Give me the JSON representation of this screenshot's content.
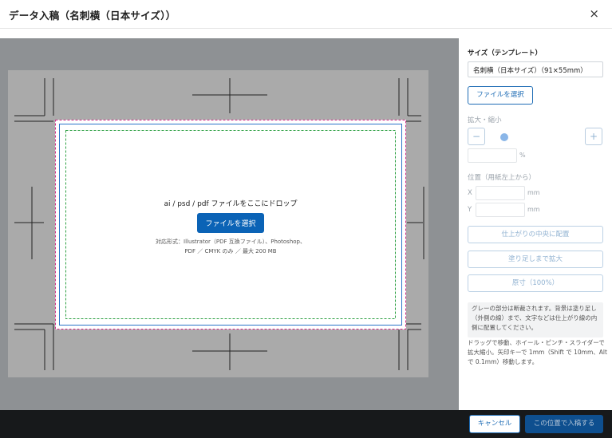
{
  "header": {
    "title": "データ入稿（名刺横（日本サイズ））",
    "close_icon": "×"
  },
  "preview": {
    "drop_title": "ai / psd / pdf ファイルをここにドロップ",
    "pick_button": "ファイルを選択",
    "formats_line1": "対応形式：Illustrator（PDF 互換ファイル）、Photoshop、",
    "formats_line2": "PDF ／ CMYK のみ ／ 最大 200 MB",
    "colors": {
      "bleed": "#d0308a",
      "trim": "#2a73c9",
      "safe": "#2ea043",
      "sheet": "#aaaaaa",
      "background": "#8e9194"
    }
  },
  "panel": {
    "size_title": "サイズ（テンプレート）",
    "size_value": "名刺横（日本サイズ）（91×55mm）",
    "file_button": "ファイルを選択",
    "scale_title": "拡大・縮小",
    "minus": "−",
    "plus": "+",
    "percent_unit": "%",
    "position_title": "位置（用紙左上から）",
    "x_label": "X",
    "y_label": "Y",
    "mm_unit": "mm",
    "center_button": "仕上がりの中央に配置",
    "fill_button": "塗り足しまで拡大",
    "original_button": "原寸（100%）",
    "info_text": "グレーの部分は断裁されます。背景は塗り足し（外側の線）まで、文字などは仕上がり線の内側に配置してください。",
    "help_text": "ドラッグで移動、ホイール・ピンチ・スライダーで拡大縮小。矢印キーで 1mm（Shift で 10mm、Alt で 0.1mm）移動します。"
  },
  "footer": {
    "cancel": "キャンセル",
    "submit": "この位置で入稿する"
  }
}
